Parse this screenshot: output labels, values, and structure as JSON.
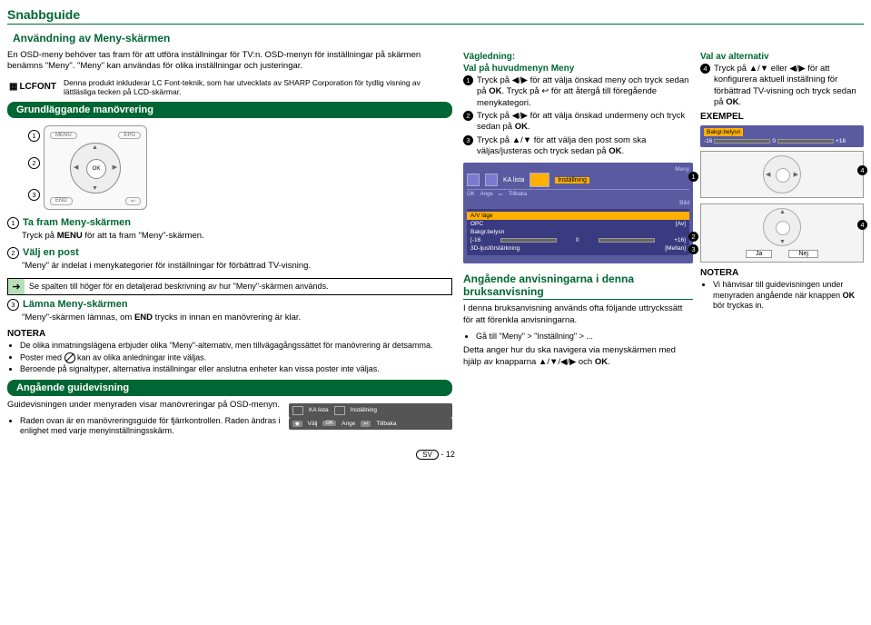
{
  "title": "Snabbguide",
  "heading": "Användning av Meny-skärmen",
  "intro": "En OSD-meny behöver tas fram för att utföra inställningar för TV:n. OSD-menyn för inställningar på skärmen benämns \"Meny\". \"Meny\" kan användas för olika inställningar och justeringar.",
  "lcfont": {
    "label": "LCFONT",
    "text": "Denna produkt inkluderar LC Font-teknik, som har utvecklats av SHARP Corporation för tydlig visning av lättläsliga tecken på LCD-skärmar."
  },
  "section1": "Grundläggande manövrering",
  "remote": {
    "menu": "MENU",
    "ok": "OK",
    "end": "END"
  },
  "step1_title": "Ta fram Meny-skärmen",
  "step1_text": "Tryck på MENU för att ta fram \"Meny\"-skärmen.",
  "step2_title": "Välj en post",
  "step2_text": "\"Meny\" är indelat i menykategorier för inställningar för förbättrad TV-visning.",
  "step2_box": "Se spalten till höger för en detaljerad beskrivning av hur \"Meny\"-skärmen används.",
  "step3_title": "Lämna Meny-skärmen",
  "step3_text": "\"Meny\"-skärmen lämnas, om END trycks in innan en manövrering är klar.",
  "notera": "NOTERA",
  "notes1": [
    "De olika inmatningslägena erbjuder olika \"Meny\"-alternativ, men tillvägagångssättet för manövrering är detsamma.",
    "Poster med kan av olika anledningar inte väljas.",
    "Beroende på signaltyper, alternativa inställningar eller anslutna enheter kan vissa poster inte väljas."
  ],
  "section2": "Angående guidevisning",
  "guide_text": "Guidevisningen under menyraden visar manövreringar på OSD-menyn.",
  "guide_bullet": "Raden ovan är en manövreringsguide för fjärrkontrollen. Raden ändras i enlighet med varje menyinställningsskärm.",
  "guide_strip": {
    "ka": "KA lista",
    "inst": "Inställning",
    "valj": "Välj",
    "ange": "Ange",
    "tillbaka": "Tillbaka"
  },
  "vag_title": "Vägledning:",
  "vag_sub": "Val på huvudmenyn Meny",
  "vag1": "Tryck på ◀/▶ för att välja önskad meny och tryck sedan på OK. Tryck på ↩ för att återgå till föregående menykategori.",
  "vag2": "Tryck på ◀/▶ för att välja önskad undermeny och tryck sedan på OK.",
  "vag3": "Tryck på ▲/▼ för att välja den post som ska väljas/justeras och tryck sedan på OK.",
  "osd": {
    "meny": "Meny",
    "ka": "KA lista",
    "inst": "Inställning",
    "ange": "Ange",
    "tillbaka": "Tillbaka",
    "bild": "Bild",
    "avlage": "A/V läge",
    "opc": "OPC",
    "av": "[Av]",
    "bakgr": "Bakgr.belysn",
    "minus": "[-16",
    "zero": "0",
    "plus": "+16]",
    "tred": "3D-ljusförstärkning",
    "mellan": "[Mellan]"
  },
  "angaende_title": "Angående anvisningarna i denna bruksanvisning",
  "angaende_text": "I denna bruksanvisning används ofta följande uttryckssätt för att förenkla anvisningarna.",
  "angaende_bullet": "Gå till \"Meny\" > \"Inställning\" > ...",
  "angaende_text2": "Detta anger hur du ska navigera via menyskärmen med hjälp av knapparna ▲/▼/◀/▶ och OK.",
  "valav_title": "Val av alternativ",
  "valav_text": "Tryck på ▲/▼ eller ◀/▶ för att konfigurera aktuell inställning för förbättrad TV-visning och tryck sedan på OK.",
  "exempel": "EXEMPEL",
  "ex_strip": {
    "label": "Bakgr.belysn",
    "minus": "-16",
    "zero": "0",
    "plus": "+16"
  },
  "janej": {
    "ja": "Ja",
    "nej": "Nej"
  },
  "notera2": "Vi hänvisar till guidevisningen under menyraden angående när knappen OK bör tryckas in.",
  "page": {
    "lang": "SV",
    "num": "12"
  }
}
